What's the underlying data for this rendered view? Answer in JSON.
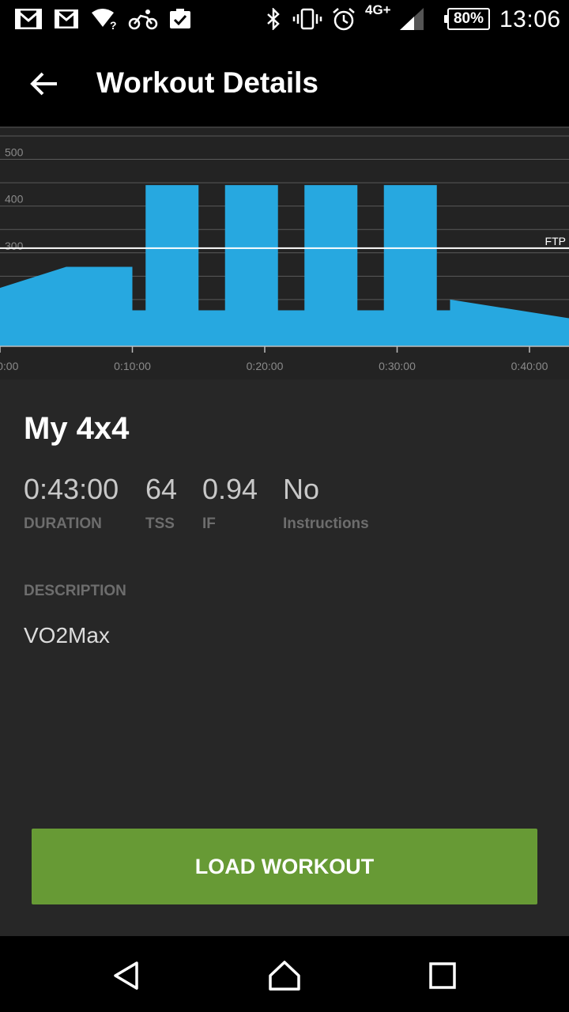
{
  "status_bar": {
    "icons": [
      "gmail-icon",
      "gmail-icon",
      "wifi-unknown-icon",
      "cycling-icon",
      "clipboard-check-icon",
      "bluetooth-icon",
      "vibrate-icon",
      "alarm-icon",
      "signal-icon"
    ],
    "network": "4G+",
    "battery": "80%",
    "time": "13:06"
  },
  "app_bar": {
    "title": "Workout Details"
  },
  "workout": {
    "name": "My 4x4",
    "stats": [
      {
        "value": "0:43:00",
        "label": "DURATION"
      },
      {
        "value": "64",
        "label": "TSS"
      },
      {
        "value": "0.94",
        "label": "IF"
      },
      {
        "value": "No",
        "label": "Instructions"
      }
    ],
    "description_label": "DESCRIPTION",
    "description": "VO2Max",
    "load_button": "LOAD WORKOUT"
  },
  "colors": {
    "bar": "#27a8e0",
    "accent_green": "#679a35",
    "ftp_line": "#ffffff"
  },
  "chart_data": {
    "type": "area",
    "x_unit": "minutes",
    "x_range": [
      0,
      43
    ],
    "y_range": [
      100,
      550
    ],
    "y_ticks": [
      "500",
      "400",
      "300",
      "200"
    ],
    "x_ticks": [
      "0:00:00",
      "0:10:00",
      "0:20:00",
      "0:30:00",
      "0:40:00"
    ],
    "ftp_label": "FTP",
    "ftp_value": 310,
    "points": [
      [
        0,
        225
      ],
      [
        5,
        270
      ],
      [
        10,
        270
      ],
      [
        10,
        177
      ],
      [
        11,
        177
      ],
      [
        11,
        445
      ],
      [
        15,
        445
      ],
      [
        15,
        177
      ],
      [
        17,
        177
      ],
      [
        17,
        445
      ],
      [
        21,
        445
      ],
      [
        21,
        177
      ],
      [
        23,
        177
      ],
      [
        23,
        445
      ],
      [
        27,
        445
      ],
      [
        27,
        177
      ],
      [
        29,
        177
      ],
      [
        29,
        445
      ],
      [
        33,
        445
      ],
      [
        33,
        177
      ],
      [
        34,
        177
      ],
      [
        34,
        200
      ],
      [
        43,
        160
      ]
    ]
  }
}
